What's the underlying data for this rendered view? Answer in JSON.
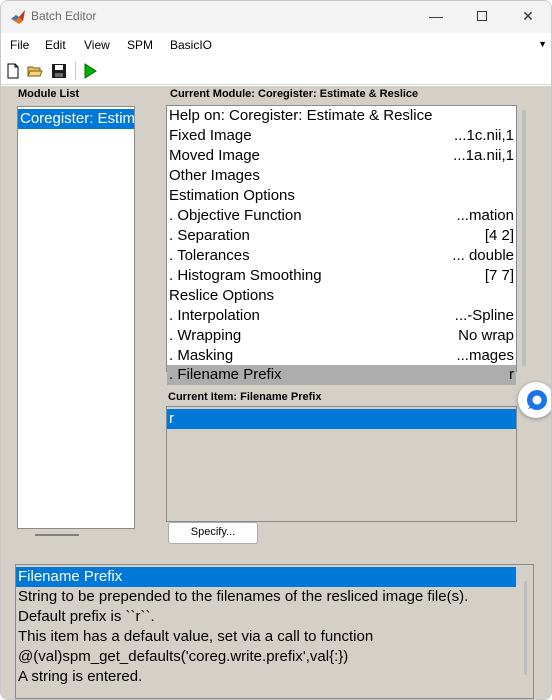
{
  "window": {
    "title": "Batch Editor"
  },
  "menubar": {
    "items": [
      "File",
      "Edit",
      "View",
      "SPM",
      "BasicIO"
    ]
  },
  "toolbar": {
    "icons": [
      "new-file-icon",
      "open-folder-icon",
      "save-icon",
      "run-icon"
    ]
  },
  "module_list": {
    "label": "Module List",
    "items": [
      {
        "label": "Coregister: Estimate & Reslice",
        "selected": true
      }
    ]
  },
  "current_module": {
    "label": "Current Module: Coregister: Estimate & Reslice",
    "rows": [
      {
        "name": "Help on: Coregister: Estimate & Reslice",
        "value": ""
      },
      {
        "name": "Fixed Image",
        "value": "...1c.nii,1"
      },
      {
        "name": "Moved Image",
        "value": "...1a.nii,1"
      },
      {
        "name": "Other Images",
        "value": ""
      },
      {
        "name": "Estimation Options",
        "value": ""
      },
      {
        "name": ". Objective Function",
        "value": "...mation"
      },
      {
        "name": ". Separation",
        "value": "[4 2]"
      },
      {
        "name": ". Tolerances",
        "value": "... double"
      },
      {
        "name": ". Histogram Smoothing",
        "value": "[7 7]"
      },
      {
        "name": "Reslice Options",
        "value": ""
      },
      {
        "name": ". Interpolation",
        "value": "...-Spline"
      },
      {
        "name": ". Wrapping",
        "value": "No wrap"
      },
      {
        "name": ". Masking",
        "value": "...mages"
      },
      {
        "name": ". Filename Prefix",
        "value": "r",
        "selected": true
      }
    ]
  },
  "current_item": {
    "label": "Current Item: Filename Prefix",
    "value": "r"
  },
  "specify_button": {
    "label": "Specify..."
  },
  "help": {
    "title": "Filename Prefix",
    "lines": [
      "String to be prepended to the filenames of the resliced image file(s).",
      "Default prefix is ``r``.",
      "This item has a default value, set via a call to function",
      "@(val)spm_get_defaults('coreg.write.prefix',val{:})",
      "A string is entered."
    ]
  },
  "colors": {
    "selection": "#0078d7",
    "panel_bg": "#d4d0c8",
    "selected_row": "#adadad"
  }
}
